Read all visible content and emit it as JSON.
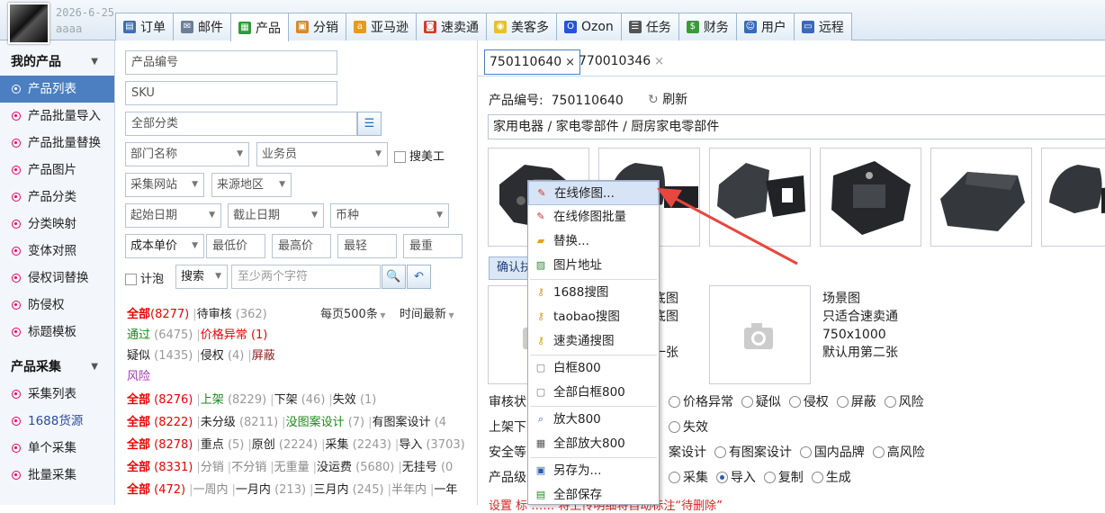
{
  "header": {
    "date": "2026-6-25",
    "user": "aaaa"
  },
  "tabs": [
    {
      "label": "订单",
      "icon": "order-icon",
      "color": "#3f6fb0"
    },
    {
      "label": "邮件",
      "icon": "mail-icon",
      "color": "#6b7f99"
    },
    {
      "label": "产品",
      "icon": "grid-icon",
      "color": "#2f9a3a"
    },
    {
      "label": "分销",
      "icon": "box-icon",
      "color": "#d58a2b"
    },
    {
      "label": "亚马逊",
      "icon": "amazon-icon",
      "color": "#e89a1c"
    },
    {
      "label": "速卖通",
      "icon": "aliexpress-icon",
      "color": "#d23b2b"
    },
    {
      "label": "美客多",
      "icon": "mercado-icon",
      "color": "#e6c12a"
    },
    {
      "label": "Ozon",
      "icon": "ozon-icon",
      "color": "#2454d8"
    },
    {
      "label": "任务",
      "icon": "task-icon",
      "color": "#555"
    },
    {
      "label": "财务",
      "icon": "money-icon",
      "color": "#3a9a3a"
    },
    {
      "label": "用户",
      "icon": "user-icon",
      "color": "#3a6ab8"
    },
    {
      "label": "远程",
      "icon": "monitor-icon",
      "color": "#3a6ab8"
    }
  ],
  "sidebar": {
    "sec1": "我的产品",
    "items1": [
      "产品列表",
      "产品批量导入",
      "产品批量替换",
      "产品图片",
      "产品分类",
      "分类映射",
      "变体对照",
      "侵权词替换",
      "防侵权",
      "标题模板"
    ],
    "sec2": "产品采集",
    "items2": [
      "采集列表",
      "1688货源",
      "单个采集",
      "批量采集"
    ]
  },
  "filters": {
    "product_no": "产品编号",
    "sku": "SKU",
    "category": "全部分类",
    "dept": "部门名称",
    "salesman": "业务员",
    "search_artist": "搜美工",
    "site": "采集网站",
    "region": "来源地区",
    "start_date": "起始日期",
    "end_date": "截止日期",
    "currency": "币种",
    "cost": "成本单价",
    "min_price": "最低价",
    "max_price": "最高价",
    "lightest": "最轻",
    "heaviest": "最重",
    "bubble": "计泡",
    "search_mode": "搜索",
    "search_placeholder": "至少两个字符"
  },
  "status": {
    "r1": {
      "all": "全部",
      "all_n": "(8277)",
      "pending": "待审核",
      "pending_n": "(362)",
      "per_page": "每页500条",
      "sort": "时间最新"
    },
    "r2": {
      "pass": "通过",
      "pass_n": "(6475)",
      "price_abn": "价格异常",
      "price_abn_n": "(1)"
    },
    "r3": {
      "suspect": "疑似",
      "suspect_n": "(1435)",
      "infringe": "侵权",
      "infringe_n": "(4)",
      "blocked": "屏蔽"
    },
    "r4": {
      "risk": "风险"
    },
    "r5": {
      "all": "全部",
      "all_n": "(8276)",
      "on": "上架",
      "on_n": "(8229)",
      "off": "下架",
      "off_n": "(46)",
      "fail": "失效",
      "fail_n": "(1)"
    },
    "r6": {
      "all": "全部",
      "all_n": "(8222)",
      "ungraded": "未分级",
      "ungraded_n": "(8211)",
      "nopat": "没图案设计",
      "nopat_n": "(7)",
      "pat": "有图案设计",
      "pat_n": "(4"
    },
    "r7": {
      "all": "全部",
      "all_n": "(8278)",
      "key": "重点",
      "key_n": "(5)",
      "orig": "原创",
      "orig_n": "(2224)",
      "coll": "采集",
      "coll_n": "(2243)",
      "imp": "导入",
      "imp_n": "(3703)"
    },
    "r8": {
      "all": "全部",
      "all_n": "(8331)",
      "sep": "分销",
      "nosep": "不分销",
      "nowt": "无重量",
      "noship": "没运费",
      "noship_n": "(5680)",
      "nohang": "无挂号",
      "nohang_n": "(0"
    },
    "r9": {
      "all": "全部",
      "all_n": "(472)",
      "week": "一周内",
      "month": "一月内",
      "month_n": "(213)",
      "m3": "三月内",
      "m3_n": "(245)",
      "half": "半年内",
      "one": "一年"
    }
  },
  "detail": {
    "tab1": "750110640",
    "tab2": "770010346",
    "pno_label": "产品编号:",
    "pno": "750110640",
    "refresh": "刷新",
    "category_path": "家用电器 / 家电零部件 / 厨房家电零部件",
    "confirm_btn": "确认扶",
    "img1_lines": [
      "底图",
      "底图",
      "一张"
    ],
    "scene_lines": [
      "场景图",
      "只适合速卖通",
      "750x1000",
      "默认用第二张"
    ],
    "audit_label": "审核状",
    "audit_opts": [
      "价格异常",
      "疑似",
      "侵权",
      "屏蔽",
      "风险"
    ],
    "shelf_label": "上架下",
    "shelf_opts": [
      "失效"
    ],
    "safety_label": "安全等",
    "safety_opts": [
      "案设计",
      "有图案设计",
      "国内品牌",
      "高风险"
    ],
    "level_label": "产品级",
    "level_opts": [
      "采集",
      "导入",
      "复制",
      "生成"
    ],
    "level_selected": "导入",
    "bottom_note": "设置 标 …… 将上传明细将自动标注“待删除”"
  },
  "context_menu": [
    {
      "label": "在线修图...",
      "icon": "edit-icon",
      "hl": true
    },
    {
      "label": "在线修图批量",
      "icon": "edit-icon"
    },
    {
      "label": "替换...",
      "icon": "folder-icon"
    },
    {
      "label": "图片地址",
      "icon": "image-icon",
      "sep": true
    },
    {
      "label": "1688搜图",
      "icon": "key-icon"
    },
    {
      "label": "taobao搜图",
      "icon": "key-icon"
    },
    {
      "label": "速卖通搜图",
      "icon": "key-icon",
      "sep": true
    },
    {
      "label": "白框800",
      "icon": "frame-icon"
    },
    {
      "label": "全部白框800",
      "icon": "frame-icon",
      "sep": true
    },
    {
      "label": "放大800",
      "icon": "zoom-icon"
    },
    {
      "label": "全部放大800",
      "icon": "grid-icon",
      "sep": true
    },
    {
      "label": "另存为...",
      "icon": "save-icon"
    },
    {
      "label": "全部保存",
      "icon": "save-all-icon"
    }
  ]
}
